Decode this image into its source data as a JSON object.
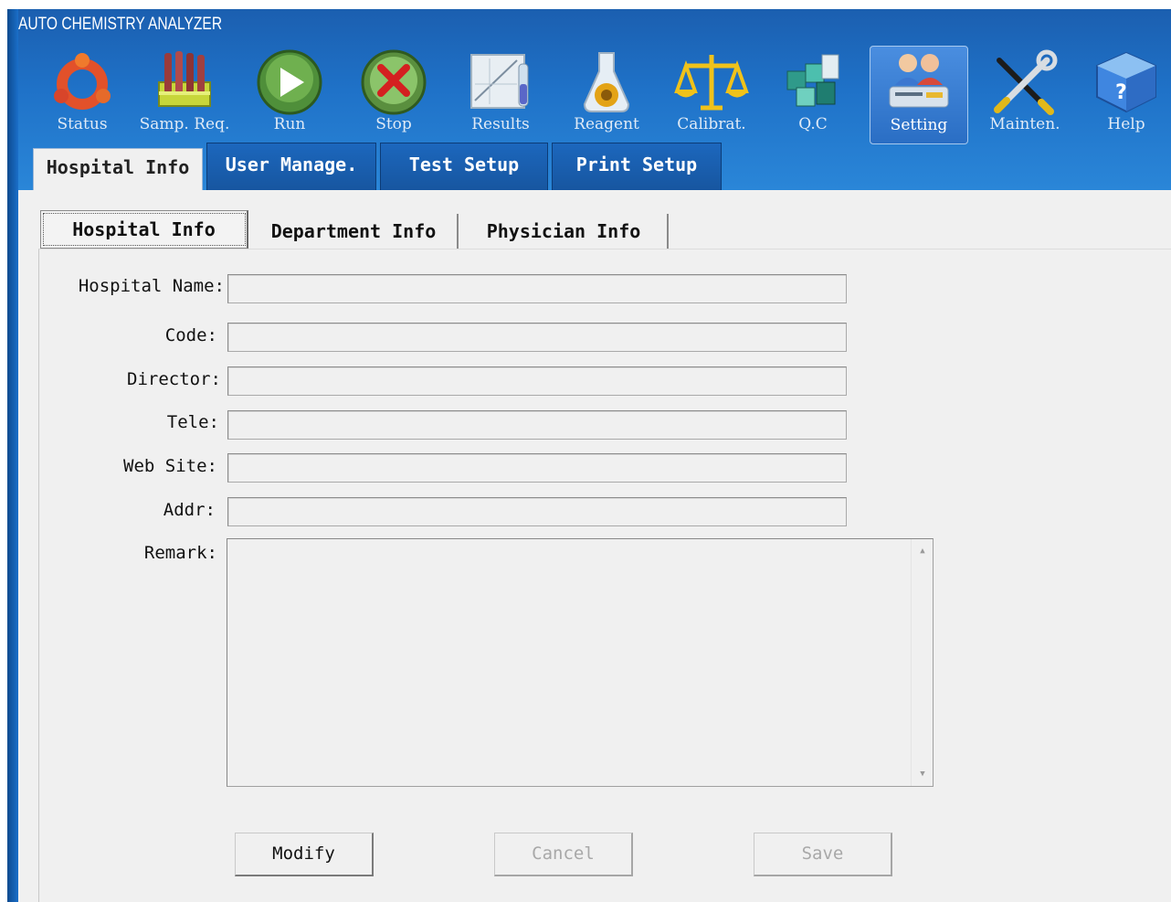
{
  "window": {
    "title": "AUTO CHEMISTRY ANALYZER"
  },
  "toolbar": {
    "items": [
      {
        "label": "Status",
        "icon": "status-ring-icon"
      },
      {
        "label": "Samp. Req.",
        "icon": "sample-tubes-icon"
      },
      {
        "label": "Run",
        "icon": "play-icon"
      },
      {
        "label": "Stop",
        "icon": "stop-x-icon"
      },
      {
        "label": "Results",
        "icon": "results-chart-icon"
      },
      {
        "label": "Reagent",
        "icon": "reagent-flask-icon"
      },
      {
        "label": "Calibrat.",
        "icon": "balance-scale-icon"
      },
      {
        "label": "Q.C",
        "icon": "qc-cubes-icon"
      },
      {
        "label": "Setting",
        "icon": "users-setting-icon"
      },
      {
        "label": "Mainten.",
        "icon": "wrench-screwdriver-icon"
      },
      {
        "label": "Help",
        "icon": "help-cube-icon"
      }
    ],
    "active": "Setting"
  },
  "main_tabs": [
    {
      "label": "Hospital Info"
    },
    {
      "label": "User Manage."
    },
    {
      "label": "Test Setup"
    },
    {
      "label": "Print Setup"
    }
  ],
  "sub_tabs": [
    {
      "label": "Hospital Info"
    },
    {
      "label": "Department Info"
    },
    {
      "label": "Physician Info"
    }
  ],
  "form": {
    "hospital_name": {
      "label": "Hospital Name:",
      "value": ""
    },
    "code": {
      "label": "Code:",
      "value": ""
    },
    "director": {
      "label": "Director:",
      "value": ""
    },
    "tele": {
      "label": "Tele:",
      "value": ""
    },
    "web_site": {
      "label": "Web Site:",
      "value": ""
    },
    "addr": {
      "label": "Addr:",
      "value": ""
    },
    "remark": {
      "label": "Remark:",
      "value": ""
    }
  },
  "buttons": {
    "modify": "Modify",
    "cancel": "Cancel",
    "save": "Save"
  },
  "colors": {
    "header_blue": "#1f72c8",
    "panel_gray": "#f0f0f0"
  }
}
